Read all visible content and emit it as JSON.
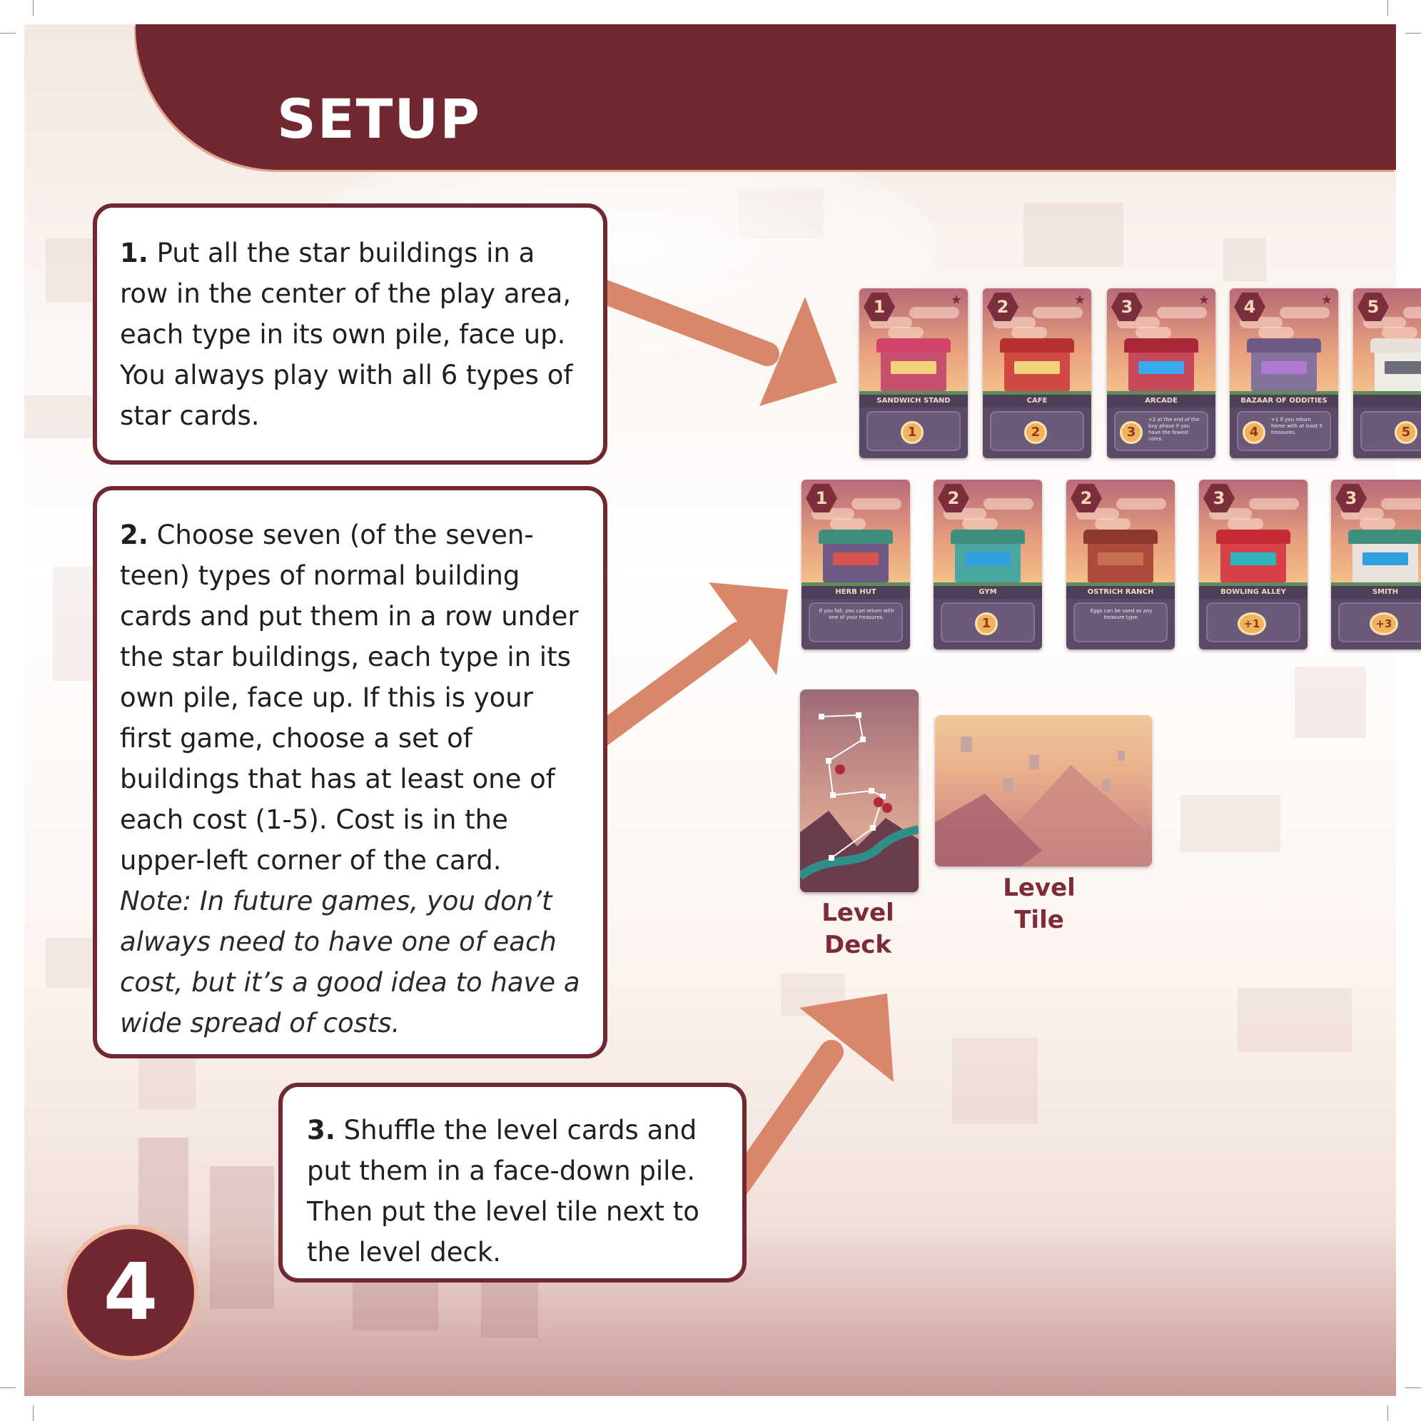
{
  "header": {
    "title": "SETUP"
  },
  "steps": [
    {
      "number": "1.",
      "text": "Put all the star buildings in a row in the center of the play area, each type in its own pile, face up. You always play with all 6 types of star cards."
    },
    {
      "number": "2.",
      "text": "Choose seven (of the seven-teen) types of normal building cards and put them in a row under the star buildings, each type in its own pile, face up. If this is your first game, choose a set of buildings that has at least one of each cost (1-5). Cost is in the upper-left corner of the card.",
      "note": "Note: In future games, you don’t always need to have one of each cost, but it’s a good idea to have a wide spread of costs."
    },
    {
      "number": "3.",
      "text": "Shuffle the level cards and put them in a face-down pile. Then put the level tile next to the level deck."
    }
  ],
  "star_cards": [
    {
      "cost": "1",
      "name": "SANDWICH STAND",
      "value": "1",
      "text": "",
      "roof": "#d2456a",
      "body": "#c6506e",
      "window": "#f2d27a"
    },
    {
      "cost": "2",
      "name": "CAFE",
      "value": "2",
      "text": "",
      "roof": "#b7322e",
      "body": "#d04a43",
      "window": "#f2d27a"
    },
    {
      "cost": "3",
      "name": "ARCADE",
      "value": "3",
      "text": "+2 at the end of the buy phase if you have the fewest coins.",
      "roof": "#a8283a",
      "body": "#c7485a",
      "window": "#3aa9f0"
    },
    {
      "cost": "4",
      "name": "BAZAAR OF ODDITIES",
      "value": "4",
      "text": "+1 if you return home with at least 5 treasures.",
      "roof": "#6f5a86",
      "body": "#86709c",
      "window": "#b07ad0"
    },
    {
      "cost": "5",
      "name": "",
      "value": "5",
      "text": "",
      "roof": "#e9e0da",
      "body": "#f1ebe6",
      "window": "#6d6d7a"
    }
  ],
  "normal_cards": [
    {
      "cost": "1",
      "name": "HERB HUT",
      "value": "",
      "text": "If you fall, you can return with one of your treasures.",
      "roof": "#3f8f7f",
      "body": "#6f5a86",
      "window": "#d9534f"
    },
    {
      "cost": "2",
      "name": "GYM",
      "value": "1",
      "text": "",
      "roof": "#3f8f7f",
      "body": "#4aa6a0",
      "window": "#2f9fe0"
    },
    {
      "cost": "2",
      "name": "OSTRICH RANCH",
      "value": "",
      "text": "Eggs can be used as any treasure type.",
      "roof": "#8c3a2e",
      "body": "#b04a3c",
      "window": "#c5704f"
    },
    {
      "cost": "3",
      "name": "BOWLING ALLEY",
      "value": "+1",
      "text": "",
      "roof": "#c42b33",
      "body": "#d9414a",
      "window": "#2fb5c0"
    },
    {
      "cost": "3",
      "name": "SMITH",
      "value": "+3",
      "text": "",
      "roof": "#3f8f7f",
      "body": "#eae2dc",
      "window": "#2f9fe0"
    }
  ],
  "level_deck": {
    "label_line1": "Level",
    "label_line2": "Deck"
  },
  "level_tile": {
    "label_line1": "Level",
    "label_line2": "Tile"
  },
  "page_number": "4",
  "colors": {
    "maroon": "#722831",
    "arrow": "#d9876a",
    "label": "#7d2b36"
  }
}
